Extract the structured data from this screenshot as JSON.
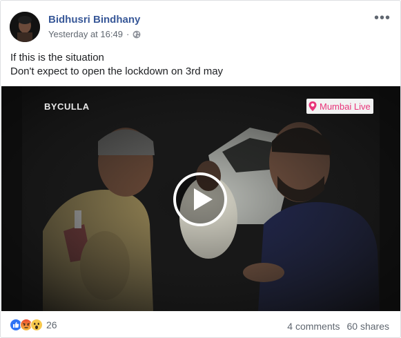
{
  "post": {
    "author": "Bidhusri Bindhany",
    "timestamp": "Yesterday at 16:49",
    "privacy_icon": "globe-icon",
    "more_label": "•••",
    "lines": [
      "If this is the situation",
      "Don't expect to open the lockdown on 3rd may"
    ]
  },
  "video": {
    "caption_left": "BYCULLA",
    "logo_text": "Mumbai Live",
    "logo_accent": "#e8347a"
  },
  "footer": {
    "reactions": [
      "like-icon",
      "angry-icon",
      "wow-icon"
    ],
    "reaction_count": "26",
    "comments": "4 comments",
    "shares": "60 shares"
  }
}
